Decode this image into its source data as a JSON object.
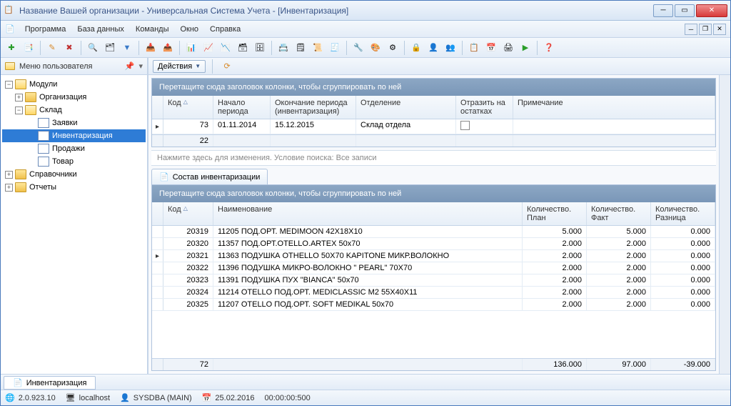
{
  "titlebar": "Название Вашей организации - Универсальная Система Учета - [Инвентаризация]",
  "menus": [
    "Программа",
    "База данных",
    "Команды",
    "Окно",
    "Справка"
  ],
  "sidebar_title": "Меню пользователя",
  "tree": {
    "root": "Модули",
    "org": "Организация",
    "warehouse": "Склад",
    "warehouse_children": [
      "Заявки",
      "Инвентаризация",
      "Продажи",
      "Товар"
    ],
    "refs": "Справочники",
    "reports": "Отчеты"
  },
  "actions_label": "Действия",
  "group_hint": "Перетащите сюда заголовок колонки, чтобы сгруппировать по ней",
  "top_cols": {
    "code": "Код",
    "period_start": "Начало периода",
    "period_end": "Окончание периода (инвентаризация)",
    "dept": "Отделение",
    "reflect": "Отразить на остатках",
    "note": "Примечание"
  },
  "top_row": {
    "code": "73",
    "start": "01.11.2014",
    "end": "15.12.2015",
    "dept": "Склад отдела"
  },
  "top_footer_code": "22",
  "search_hint": "Нажмите здесь для изменения. Условие поиска: Все записи",
  "subtab_label": "Состав инвентаризации",
  "detail_cols": {
    "code": "Код",
    "name": "Наименование",
    "qplan": "Количество. План",
    "qfact": "Количество. Факт",
    "qdiff": "Количество. Разница"
  },
  "detail_rows": [
    {
      "code": "20319",
      "name": "11205 ПОД.ОРТ. MEDIMOON 42X18X10",
      "plan": "5.000",
      "fact": "5.000",
      "diff": "0.000"
    },
    {
      "code": "20320",
      "name": "11357 ПОД.ОРТ.OTELLO.ARTEX 50x70",
      "plan": "2.000",
      "fact": "2.000",
      "diff": "0.000"
    },
    {
      "code": "20321",
      "name": "11363 ПОДУШКА OTHELLO 50X70 KAPITONE МИКР.ВОЛОКНО",
      "plan": "2.000",
      "fact": "2.000",
      "diff": "0.000"
    },
    {
      "code": "20322",
      "name": "11396 ПОДУШКА МИКРО-ВОЛОКНО \" PEARL\" 70X70",
      "plan": "2.000",
      "fact": "2.000",
      "diff": "0.000"
    },
    {
      "code": "20323",
      "name": "11391 ПОДУШКА ПУХ \"BIANCA\" 50x70",
      "plan": "2.000",
      "fact": "2.000",
      "diff": "0.000"
    },
    {
      "code": "20324",
      "name": "11214 OTELLO ПОД.ОРТ. MEDICLASSIC M2 55X40X11",
      "plan": "2.000",
      "fact": "2.000",
      "diff": "0.000"
    },
    {
      "code": "20325",
      "name": "11207 OTELLO ПОД.ОРТ. SOFT MEDIKAL 50x70",
      "plan": "2.000",
      "fact": "2.000",
      "diff": "0.000"
    }
  ],
  "detail_footer": {
    "code": "72",
    "plan": "136.000",
    "fact": "97.000",
    "diff": "-39.000"
  },
  "childtab": "Инвентаризация",
  "status": {
    "version": "2.0.923.10",
    "host": "localhost",
    "user": "SYSDBA (MAIN)",
    "date": "25.02.2016",
    "time": "00:00:00:500"
  }
}
